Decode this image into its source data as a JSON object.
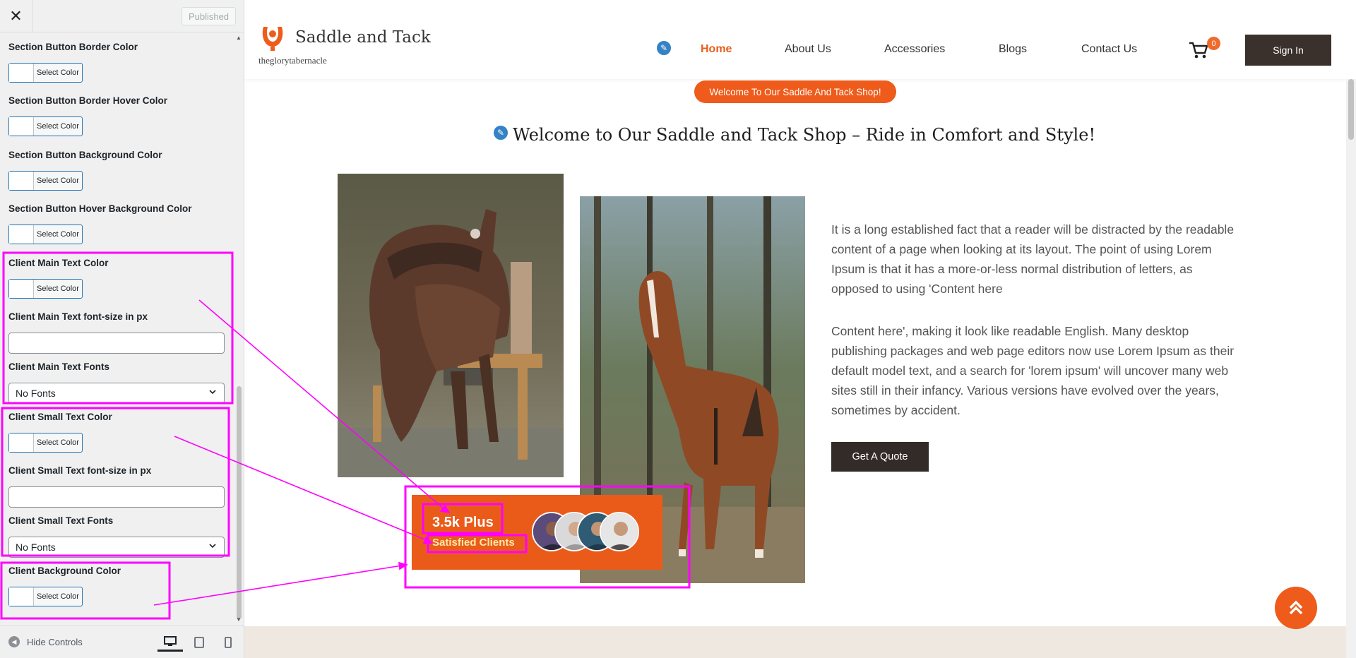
{
  "sidebar": {
    "close_label": "✕",
    "publish_label": "Published",
    "color_button_label": "Select Color",
    "fields": {
      "btn_border": "Section Button Border Color",
      "btn_border_hover": "Section Button Border Hover Color",
      "btn_bg": "Section Button Background Color",
      "btn_hover_bg": "Section Button Hover Background Color",
      "client_main_color": "Client Main Text Color",
      "client_main_size": "Client Main Text font-size in px",
      "client_main_fonts": "Client Main Text Fonts",
      "client_small_color": "Client Small Text Color",
      "client_small_size": "Client Small Text font-size in px",
      "client_small_fonts": "Client Small Text Fonts",
      "client_bg": "Client Background Color"
    },
    "fonts_selected": "No Fonts",
    "footer": {
      "hide_controls": "Hide Controls"
    }
  },
  "site": {
    "title": "Saddle and Tack",
    "tagline": "theglorytabernacle",
    "nav": [
      "Home",
      "About Us",
      "Accessories",
      "Blogs",
      "Contact Us"
    ],
    "cart_count": "0",
    "sign_in": "Sign In",
    "welcome_pill": "Welcome To Our Saddle And Tack Shop!",
    "heading": "Welcome to Our Saddle and Tack Shop – Ride in Comfort and Style!",
    "paragraph_1": "It is a long established fact that a reader will be distracted by the readable content of a page when looking at its layout. The point of using Lorem Ipsum is that it has a more-or-less normal distribution of letters, as opposed to using 'Content here",
    "paragraph_2": "Content here', making it look like readable English. Many desktop publishing packages and web page editors now use Lorem Ipsum as their default model text, and a search for 'lorem ipsum' will uncover many web sites still in their infancy. Various versions have evolved over the years, sometimes by accident.",
    "quote_button": "Get A Quote",
    "client_main_text": "3.5k Plus",
    "client_small_text": "Satisfied Clients",
    "scroll_top_icon": "double-chevron-up-icon"
  },
  "colors": {
    "accent": "#ee5b1b",
    "dark_button": "#3a302c",
    "annotation": "#ff00ff",
    "wp_blue": "#2271b1"
  }
}
